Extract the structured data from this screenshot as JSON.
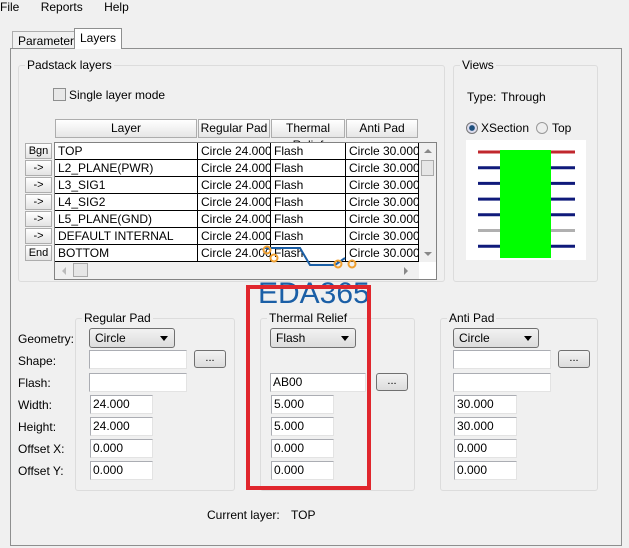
{
  "menu": [
    "File",
    "Reports",
    "Help"
  ],
  "tabs": [
    "Parameters",
    "Layers"
  ],
  "padstack": {
    "title": "Padstack layers",
    "single_layer_mode": "Single layer mode",
    "single_layer_checked": false,
    "columns": [
      "Layer",
      "Regular Pad",
      "Thermal Relief",
      "Anti Pad"
    ],
    "row_buttons": [
      "Bgn",
      "->",
      "->",
      "->",
      "->",
      "->",
      "End"
    ],
    "rows": [
      [
        "TOP",
        "Circle 24.000",
        "Flash",
        "Circle 30.000"
      ],
      [
        "L2_PLANE(PWR)",
        "Circle 24.000",
        "Flash",
        "Circle 30.000"
      ],
      [
        "L3_SIG1",
        "Circle 24.000",
        "Flash",
        "Circle 30.000"
      ],
      [
        "L4_SIG2",
        "Circle 24.000",
        "Flash",
        "Circle 30.000"
      ],
      [
        "L5_PLANE(GND)",
        "Circle 24.000",
        "Flash",
        "Circle 30.000"
      ],
      [
        "DEFAULT INTERNAL",
        "Circle 24.000",
        "Flash",
        "Circle 30.000"
      ],
      [
        "BOTTOM",
        "Circle 24.000",
        "Flash",
        "Circle 30.000"
      ]
    ]
  },
  "views": {
    "title": "Views",
    "type_label": "Type:",
    "type_value": "Through",
    "xsection": "XSection",
    "top": "Top",
    "selected": "XSection",
    "colors": {
      "top_layer": "#c0272d",
      "inner_layer": "#0f1a7a",
      "default_layer": "#b0b0b0",
      "drill": "#00ff00"
    }
  },
  "labels": {
    "geometry": "Geometry:",
    "shape": "Shape:",
    "flash": "Flash:",
    "width": "Width:",
    "height": "Height:",
    "offset_x": "Offset X:",
    "offset_y": "Offset Y:"
  },
  "browse": "...",
  "regular_pad": {
    "title": "Regular Pad",
    "geometry": "Circle",
    "shape": "",
    "flash": "",
    "width": "24.000",
    "height": "24.000",
    "offset_x": "0.000",
    "offset_y": "0.000"
  },
  "thermal_relief": {
    "title": "Thermal Relief",
    "geometry": "Flash",
    "flash": "AB00",
    "width": "5.000",
    "height": "5.000",
    "offset_x": "0.000",
    "offset_y": "0.000"
  },
  "anti_pad": {
    "title": "Anti Pad",
    "geometry": "Circle",
    "shape": "",
    "flash": "",
    "width": "30.000",
    "height": "30.000",
    "offset_x": "0.000",
    "offset_y": "0.000"
  },
  "current_layer": {
    "label": "Current layer:",
    "value": "TOP"
  },
  "watermark": "EDA365",
  "highlight_color": "#e0262d"
}
